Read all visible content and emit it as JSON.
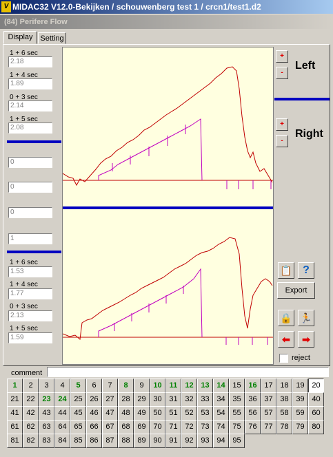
{
  "window": {
    "title": "MIDAC32 V12.0-Bekijken / schouwenberg test 1 / crcn1/test1.d2",
    "icon_letter": "V"
  },
  "panel": {
    "subtitle": "(84) Perifere Flow"
  },
  "tabs": [
    {
      "label": "Display",
      "active": true
    },
    {
      "label": "Setting",
      "active": false
    }
  ],
  "left_top": [
    {
      "label": "1 + 6 sec",
      "value": "2.18"
    },
    {
      "label": "1 + 4 sec",
      "value": "1.89"
    },
    {
      "label": "0 + 3 sec",
      "value": "2.14"
    },
    {
      "label": "1 + 5 sec",
      "value": "2.08"
    }
  ],
  "left_mid": [
    "0",
    "0",
    "0",
    "1"
  ],
  "left_bottom": [
    {
      "label": "1 + 6 sec",
      "value": "1.53"
    },
    {
      "label": "1 + 4 sec",
      "value": "1.77"
    },
    {
      "label": "0 + 3 sec",
      "value": "2.13"
    },
    {
      "label": "1 + 5 sec",
      "value": "1.59"
    }
  ],
  "right": {
    "left_label": "Left",
    "right_label": "Right",
    "plus": "+",
    "minus": "-",
    "export_label": "Export",
    "help_glyph": "?",
    "reject_label": "reject",
    "reject_checked": false
  },
  "comment": {
    "label": "comment",
    "value": ""
  },
  "grid": {
    "cells": [
      {
        "n": "1",
        "a": true
      },
      {
        "n": "2",
        "a": false
      },
      {
        "n": "3",
        "a": false
      },
      {
        "n": "4",
        "a": false
      },
      {
        "n": "5",
        "a": true
      },
      {
        "n": "6",
        "a": false
      },
      {
        "n": "7",
        "a": false
      },
      {
        "n": "8",
        "a": true
      },
      {
        "n": "9",
        "a": false
      },
      {
        "n": "10",
        "a": true
      },
      {
        "n": "11",
        "a": true
      },
      {
        "n": "12",
        "a": true
      },
      {
        "n": "13",
        "a": true
      },
      {
        "n": "14",
        "a": true
      },
      {
        "n": "15",
        "a": false
      },
      {
        "n": "16",
        "a": true
      },
      {
        "n": "17",
        "a": false
      },
      {
        "n": "18",
        "a": false
      },
      {
        "n": "19",
        "a": false
      },
      {
        "n": "20",
        "a": false,
        "sel": true
      },
      {
        "n": "21",
        "a": false
      },
      {
        "n": "22",
        "a": false
      },
      {
        "n": "23",
        "a": true
      },
      {
        "n": "24",
        "a": true
      },
      {
        "n": "25",
        "a": false
      },
      {
        "n": "26",
        "a": false
      },
      {
        "n": "27",
        "a": false
      },
      {
        "n": "28",
        "a": false
      },
      {
        "n": "29",
        "a": false
      },
      {
        "n": "30",
        "a": false
      },
      {
        "n": "31",
        "a": false
      },
      {
        "n": "32",
        "a": false
      },
      {
        "n": "33",
        "a": false
      },
      {
        "n": "34",
        "a": false
      },
      {
        "n": "35",
        "a": false
      },
      {
        "n": "36",
        "a": false
      },
      {
        "n": "37",
        "a": false
      },
      {
        "n": "38",
        "a": false
      },
      {
        "n": "39",
        "a": false
      },
      {
        "n": "40",
        "a": false
      },
      {
        "n": "41",
        "a": false
      },
      {
        "n": "42",
        "a": false
      },
      {
        "n": "43",
        "a": false
      },
      {
        "n": "44",
        "a": false
      },
      {
        "n": "45",
        "a": false
      },
      {
        "n": "46",
        "a": false
      },
      {
        "n": "47",
        "a": false
      },
      {
        "n": "48",
        "a": false
      },
      {
        "n": "49",
        "a": false
      },
      {
        "n": "50",
        "a": false
      },
      {
        "n": "51",
        "a": false
      },
      {
        "n": "52",
        "a": false
      },
      {
        "n": "53",
        "a": false
      },
      {
        "n": "54",
        "a": false
      },
      {
        "n": "55",
        "a": false
      },
      {
        "n": "56",
        "a": false
      },
      {
        "n": "57",
        "a": false
      },
      {
        "n": "58",
        "a": false
      },
      {
        "n": "59",
        "a": false
      },
      {
        "n": "60",
        "a": false
      },
      {
        "n": "61",
        "a": false
      },
      {
        "n": "62",
        "a": false
      },
      {
        "n": "63",
        "a": false
      },
      {
        "n": "64",
        "a": false
      },
      {
        "n": "65",
        "a": false
      },
      {
        "n": "66",
        "a": false
      },
      {
        "n": "67",
        "a": false
      },
      {
        "n": "68",
        "a": false
      },
      {
        "n": "69",
        "a": false
      },
      {
        "n": "70",
        "a": false
      },
      {
        "n": "71",
        "a": false
      },
      {
        "n": "72",
        "a": false
      },
      {
        "n": "73",
        "a": false
      },
      {
        "n": "74",
        "a": false
      },
      {
        "n": "75",
        "a": false
      },
      {
        "n": "76",
        "a": false
      },
      {
        "n": "77",
        "a": false
      },
      {
        "n": "78",
        "a": false
      },
      {
        "n": "79",
        "a": false
      },
      {
        "n": "80",
        "a": false
      },
      {
        "n": "81",
        "a": false
      },
      {
        "n": "82",
        "a": false
      },
      {
        "n": "83",
        "a": false
      },
      {
        "n": "84",
        "a": false
      },
      {
        "n": "85",
        "a": false
      },
      {
        "n": "86",
        "a": false
      },
      {
        "n": "87",
        "a": false
      },
      {
        "n": "88",
        "a": false
      },
      {
        "n": "89",
        "a": false
      },
      {
        "n": "90",
        "a": false
      },
      {
        "n": "91",
        "a": false
      },
      {
        "n": "92",
        "a": false
      },
      {
        "n": "93",
        "a": false
      },
      {
        "n": "94",
        "a": false
      },
      {
        "n": "95",
        "a": false
      }
    ]
  },
  "colors": {
    "trace": "#c00000",
    "ramp": "#c000c0",
    "divider": "#0000c0",
    "chart_bg": "#ffffe0",
    "active_number": "#008000"
  },
  "icons": {
    "clipboard": "clipboard-icon",
    "help": "help-icon",
    "lock": "lock-icon",
    "runner": "runner-icon",
    "prev": "arrow-left-icon",
    "next": "arrow-right-icon"
  }
}
